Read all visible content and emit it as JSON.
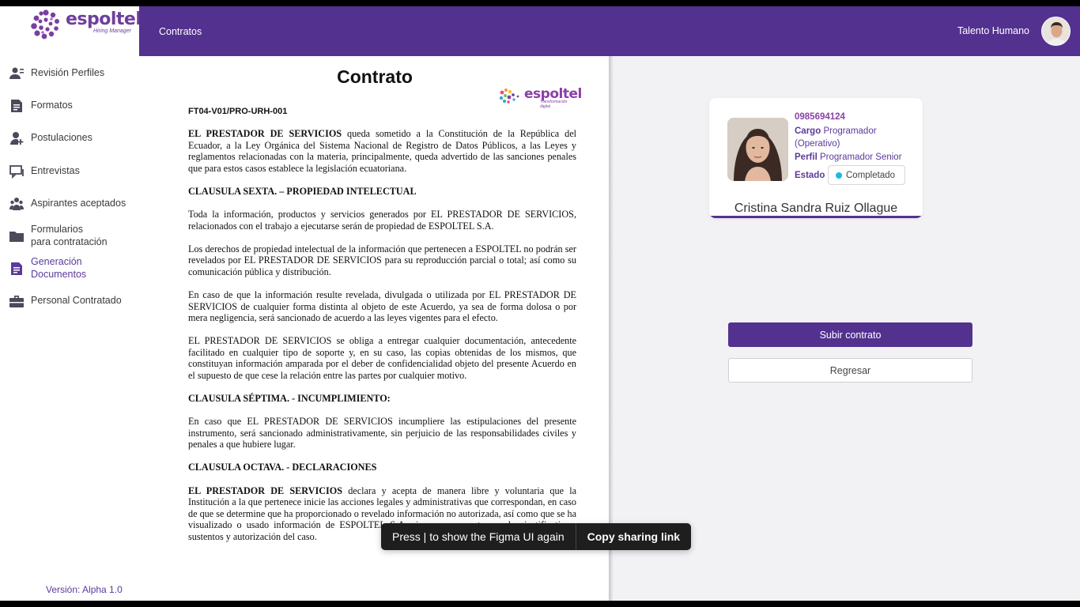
{
  "app": {
    "logo_text": "espoltel",
    "logo_sub": "Hiring Manager",
    "version": "Versión: Alpha 1.0"
  },
  "header": {
    "title": "Contratos",
    "user": "Talento Humano"
  },
  "sidebar": {
    "items": [
      {
        "label": "Revisión Perfiles",
        "icon": "users-list-icon"
      },
      {
        "label": "Formatos",
        "icon": "document-icon"
      },
      {
        "label": "Postulaciones",
        "icon": "add-user-icon"
      },
      {
        "label": "Entrevistas",
        "icon": "chat-icon"
      },
      {
        "label": "Aspirantes aceptados",
        "icon": "group-icon"
      },
      {
        "label": "Formularios",
        "label2": "para contratación",
        "icon": "folder-icon"
      },
      {
        "label": "Generación",
        "label2": "Documentos",
        "icon": "document-icon",
        "active": true
      },
      {
        "label": "Personal Contratado",
        "icon": "briefcase-icon"
      }
    ]
  },
  "document": {
    "title": "Contrato",
    "logo_text": "espoltel",
    "logo_sub": "Transformación digital",
    "code": "FT04-V01/PRO-URH-001",
    "p1_bold": "EL PRESTADOR DE SERVICIOS",
    "p1_rest": " queda sometido a la Constitución de la República del Ecuador, a la Ley Orgánica del Sistema Nacional de Registro de Datos Públicos, a las Leyes y reglamentos relacionadas con la materia, principalmente, queda advertido de las sanciones penales que para estos casos establece la legislación ecuatoriana.",
    "h6": "CLAUSULA SEXTA. – PROPIEDAD INTELECTUAL",
    "p2": "Toda la información, productos y servicios generados por EL PRESTADOR DE SERVICIOS, relacionados con el trabajo a ejecutarse serán de propiedad de ESPOLTEL S.A.",
    "p3": "Los derechos de propiedad intelectual de la información que pertenecen a ESPOLTEL no podrán ser revelados por EL PRESTADOR DE SERVICIOS para su reproducción parcial o total; así como su comunicación pública y distribución.",
    "p4": "En caso de que la información resulte revelada, divulgada o utilizada por EL PRESTADOR DE SERVICIOS de cualquier forma distinta al objeto de este Acuerdo, ya sea de forma dolosa o por mera negligencia, será sancionado de acuerdo a las leyes vigentes para el efecto.",
    "p5": "EL PRESTADOR DE SERVICIOS se obliga a entregar cualquier documentación, antecedente facilitado en cualquier tipo de soporte y, en su caso, las copias obtenidas de los mismos, que constituyan información amparada por el deber de confidencialidad objeto del presente Acuerdo en el supuesto de que cese la relación entre las partes por cualquier motivo.",
    "h7": "CLAUSULA SÉPTIMA. - INCUMPLIMIENTO:",
    "p6": "En caso que EL PRESTADOR DE SERVICIOS incumpliere las estipulaciones del presente instrumento, será sancionado administrativamente, sin perjuicio de las responsabilidades civiles y penales a que hubiere lugar.",
    "h8": "CLAUSULA OCTAVA. - DECLARACIONES",
    "p7_bold": "EL PRESTADOR DE SERVICIOS",
    "p7_rest": " declara y acepta de manera libre y voluntaria que la Institución a la que pertenece inicie las acciones legales y administrativas que correspondan, en caso de que se determine que ha proporcionado o revelado información no autorizada, así como que se ha visualizado o usado información de ESPOLTEL S.A. sin que se cuente con los justificativos, sustentos y autorización del caso."
  },
  "candidate": {
    "phone": "0985694124",
    "cargo_label": "Cargo",
    "cargo_value": "Programador (Operativo)",
    "perfil_label": "Perfil",
    "perfil_value": "Programador Senior",
    "estado_label": "Estado",
    "estado_value": "Completado",
    "name": "Cristina Sandra Ruiz Ollague"
  },
  "actions": {
    "upload": "Subir contrato",
    "back": "Regresar"
  },
  "toast": {
    "message": "Press | to show the Figma UI again",
    "link": "Copy sharing link"
  },
  "colors": {
    "brand": "#53318f",
    "accent": "#8a3fa6",
    "status_dot": "#1fb6e8"
  }
}
